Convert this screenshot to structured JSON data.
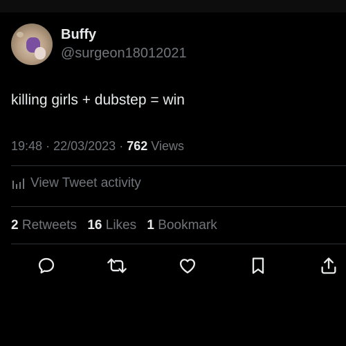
{
  "tweet": {
    "author": {
      "display_name": "Buffy",
      "handle": "@surgeon18012021"
    },
    "text": "killing girls + dubstep = win",
    "time": "19:48",
    "date": "22/03/2023",
    "views_count": "762",
    "views_label": "Views",
    "separator": "·"
  },
  "activity": {
    "label": "View Tweet activity",
    "icon": "analytics-icon"
  },
  "stats": {
    "retweets_count": "2",
    "retweets_label": "Retweets",
    "likes_count": "16",
    "likes_label": "Likes",
    "bookmarks_count": "1",
    "bookmarks_label": "Bookmark"
  },
  "actions": [
    {
      "name": "reply",
      "icon": "reply-icon"
    },
    {
      "name": "retweet",
      "icon": "retweet-icon"
    },
    {
      "name": "like",
      "icon": "heart-icon"
    },
    {
      "name": "bookmark",
      "icon": "bookmark-icon"
    },
    {
      "name": "share",
      "icon": "share-icon"
    }
  ],
  "colors": {
    "background": "#000000",
    "text_primary": "#e7e9ea",
    "text_secondary": "#71767b",
    "divider": "#2f3336"
  }
}
